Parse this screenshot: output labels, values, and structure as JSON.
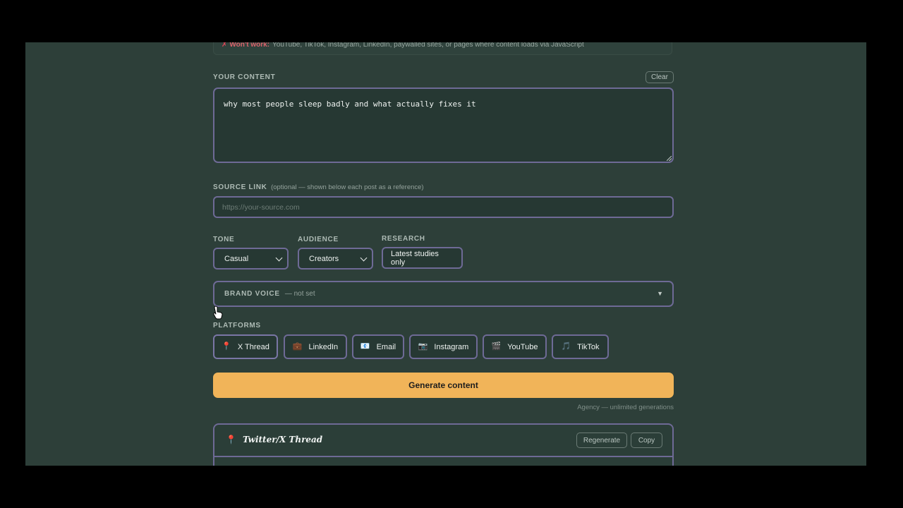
{
  "notice": {
    "icon": "✗",
    "warning": "Won't work:",
    "text": "YouTube, TikTok, Instagram, LinkedIn, paywalled sites, or pages where content loads via JavaScript"
  },
  "content": {
    "label": "YOUR CONTENT",
    "clear_label": "Clear",
    "value": "why most people sleep badly and what actually fixes it"
  },
  "source": {
    "label": "SOURCE LINK",
    "hint": "(optional — shown below each post as a reference)",
    "placeholder": "https://your-source.com"
  },
  "tone": {
    "label": "TONE",
    "value": "Casual"
  },
  "audience": {
    "label": "AUDIENCE",
    "value": "Creators"
  },
  "research": {
    "label": "RESEARCH",
    "value": "Latest studies only"
  },
  "brand_voice": {
    "label": "BRAND VOICE",
    "status": "— not set",
    "caret": "▼"
  },
  "platforms": {
    "label": "PLATFORMS",
    "items": [
      {
        "label": "X Thread",
        "icon": "pin-icon",
        "glyph": "📍"
      },
      {
        "label": "LinkedIn",
        "icon": "briefcase-icon",
        "glyph": "💼"
      },
      {
        "label": "Email",
        "icon": "email-icon",
        "glyph": "📧"
      },
      {
        "label": "Instagram",
        "icon": "camera-icon",
        "glyph": "📷"
      },
      {
        "label": "YouTube",
        "icon": "clapper-icon",
        "glyph": "🎬"
      },
      {
        "label": "TikTok",
        "icon": "music-note-icon",
        "glyph": "🎵"
      }
    ]
  },
  "generate": {
    "label": "Generate content",
    "note": "Agency — unlimited generations"
  },
  "result": {
    "icon_glyph": "📍",
    "title": "Twitter/X Thread",
    "regenerate_label": "Regenerate",
    "copy_label": "Copy"
  },
  "colors": {
    "background": "#2d3f39",
    "accent": "#f1b459",
    "border": "#6e6a96"
  }
}
